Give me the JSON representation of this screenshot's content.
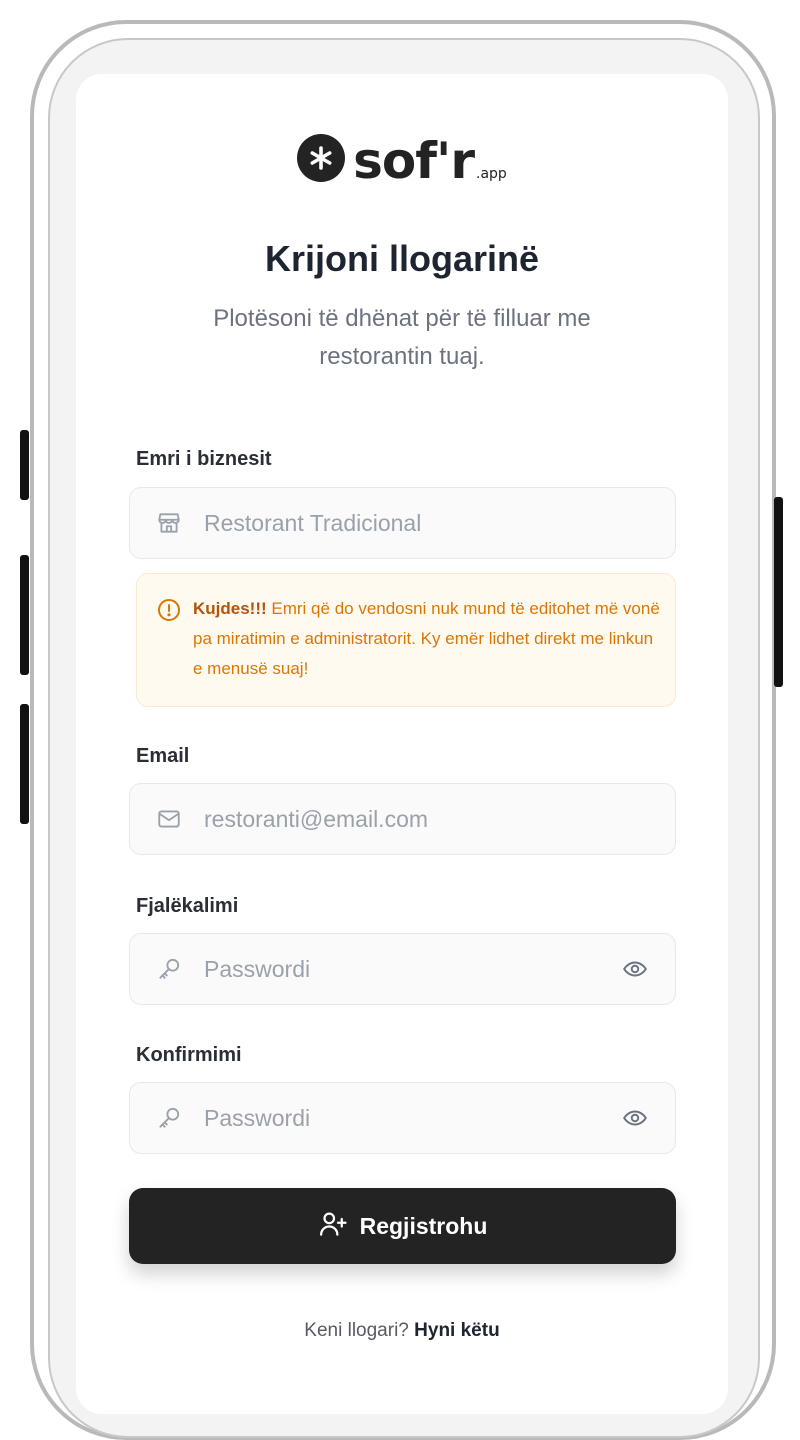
{
  "brand": {
    "name": "sof'r",
    "suffix": ".app",
    "logo_icon": "asterisk-icon",
    "color": "#232323"
  },
  "page": {
    "title": "Krijoni llogarinë",
    "subtitle": "Plotësoni të dhënat për të filluar me restorantin tuaj."
  },
  "form": {
    "business": {
      "label": "Emri i biznesit",
      "placeholder": "Restorant Tradicional",
      "value": "",
      "icon": "store-icon"
    },
    "warning": {
      "strong": "Kujdes!!!",
      "text": " Emri që do vendosni nuk mund të editohet më vonë pa miratimin e administratorit. Ky emër lidhet direkt me linkun e menusë suaj!",
      "icon": "alert-circle-icon",
      "color": "#d97706"
    },
    "email": {
      "label": "Email",
      "placeholder": "restoranti@email.com",
      "value": "",
      "icon": "mail-icon"
    },
    "password": {
      "label": "Fjalëkalimi",
      "placeholder": "Passwordi",
      "value": "",
      "icon": "key-icon"
    },
    "confirm": {
      "label": "Konfirmimi",
      "placeholder": "Passwordi",
      "value": "",
      "icon": "key-icon"
    },
    "submit": {
      "label": "Regjistrohu",
      "icon": "user-plus-icon"
    }
  },
  "footer": {
    "prompt": "Keni llogari?",
    "link": "Hyni këtu"
  }
}
